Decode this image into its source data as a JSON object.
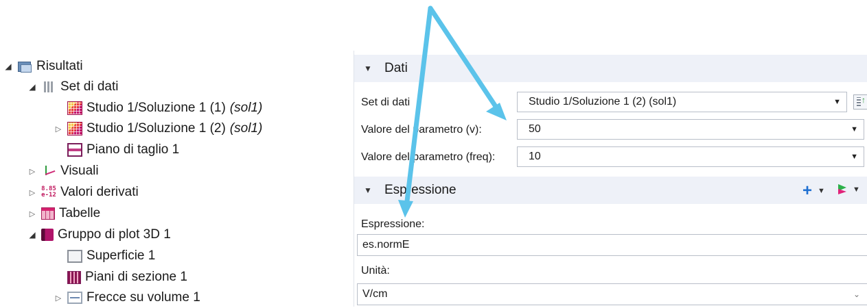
{
  "tree": {
    "items": [
      {
        "label": "Risultati",
        "icon": "results-icon",
        "expander": "open"
      },
      {
        "label": "Set di dati",
        "icon": "dataset-icon",
        "expander": "open"
      },
      {
        "label": "Studio 1/Soluzione 1 (1)",
        "suffix": "(sol1)",
        "icon": "solution-icon",
        "expander": "none"
      },
      {
        "label": "Studio 1/Soluzione 1 (2)",
        "suffix": "(sol1)",
        "icon": "solution-icon",
        "expander": "closed"
      },
      {
        "label": "Piano di taglio 1",
        "icon": "cut-plane-icon",
        "expander": "none"
      },
      {
        "label": "Visuali",
        "icon": "views-icon",
        "expander": "closed"
      },
      {
        "label": "Valori derivati",
        "icon": "derived-values-icon",
        "icon_text": "8.85 e-12",
        "expander": "closed"
      },
      {
        "label": "Tabelle",
        "icon": "tables-icon",
        "expander": "closed"
      },
      {
        "label": "Gruppo di plot 3D 1",
        "icon": "plot-group-icon",
        "expander": "open"
      },
      {
        "label": "Superficie 1",
        "icon": "surface-icon",
        "expander": "none"
      },
      {
        "label": "Piani di sezione 1",
        "icon": "slice-icon",
        "expander": "none"
      },
      {
        "label": "Frecce su volume 1",
        "icon": "arrow-volume-icon",
        "expander": "closed"
      }
    ],
    "derived_icon_top": "8.85",
    "derived_icon_bottom": "e-12"
  },
  "settings": {
    "dati_section": {
      "title": "Dati",
      "dataset_label": "Set di dati",
      "dataset_value": "Studio 1/Soluzione 1 (2) (sol1)",
      "param_v_label": "Valore del parametro (v):",
      "param_v_value": "50",
      "param_freq_label": "Valore del parametro (freq):",
      "param_freq_value": "10"
    },
    "expr_section": {
      "title": "Espressione",
      "expression_label": "Espressione:",
      "expression_value": "es.normE",
      "unit_label": "Unità:",
      "unit_value": "V/cm"
    }
  },
  "colors": {
    "arrow": "#5bc3ea",
    "section_bg": "#eef1f8",
    "accent_blue": "#1f6fd1"
  }
}
